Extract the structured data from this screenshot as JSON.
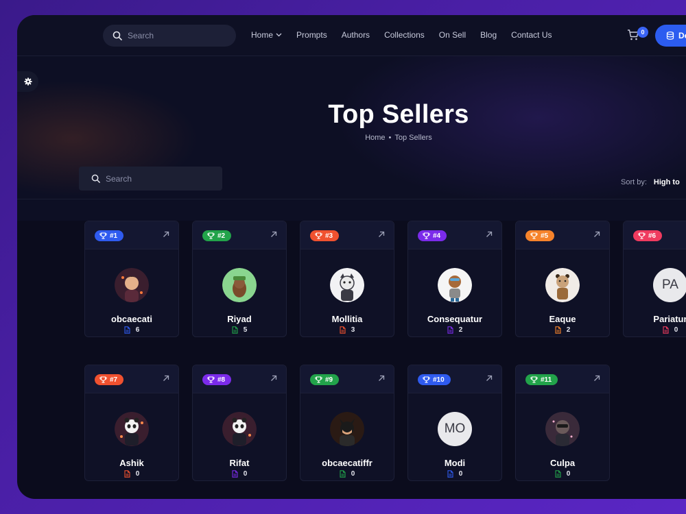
{
  "nav": {
    "search_placeholder": "Search",
    "items": [
      "Home",
      "Prompts",
      "Authors",
      "Collections",
      "On Sell",
      "Blog",
      "Contact Us"
    ],
    "cart_count": "0",
    "cta_label": "Do"
  },
  "page": {
    "title": "Top Sellers",
    "breadcrumb": [
      "Home",
      "Top Sellers"
    ]
  },
  "filters": {
    "search_placeholder": "Search",
    "sort_label": "Sort by:",
    "sort_value": "High to"
  },
  "colors": {
    "accent": "#2c5cf0",
    "background": "#0b0c1d"
  },
  "sellers": [
    {
      "rank": "#1",
      "name": "obcaecati",
      "count": "6",
      "color": "#2f5bef",
      "avatar": "img"
    },
    {
      "rank": "#2",
      "name": "Riyad",
      "count": "5",
      "color": "#22a34a",
      "avatar": "img"
    },
    {
      "rank": "#3",
      "name": "Mollitia",
      "count": "3",
      "color": "#f0512f",
      "avatar": "img"
    },
    {
      "rank": "#4",
      "name": "Consequatur",
      "count": "2",
      "color": "#7b2bea",
      "avatar": "img"
    },
    {
      "rank": "#5",
      "name": "Eaque",
      "count": "2",
      "color": "#f6832b",
      "avatar": "img"
    },
    {
      "rank": "#6",
      "name": "Pariatur",
      "count": "0",
      "color": "#ef3b5f",
      "avatar": "PA"
    },
    {
      "rank": "#7",
      "name": "Ashik",
      "count": "0",
      "color": "#f0512f",
      "avatar": "img"
    },
    {
      "rank": "#8",
      "name": "Rifat",
      "count": "0",
      "color": "#7b2bea",
      "avatar": "img"
    },
    {
      "rank": "#9",
      "name": "obcaecatiffr",
      "count": "0",
      "color": "#22a34a",
      "avatar": "img"
    },
    {
      "rank": "#10",
      "name": "Modi",
      "count": "0",
      "color": "#2f5bef",
      "avatar": "MO"
    },
    {
      "rank": "#11",
      "name": "Culpa",
      "count": "0",
      "color": "#22a34a",
      "avatar": "img"
    }
  ]
}
